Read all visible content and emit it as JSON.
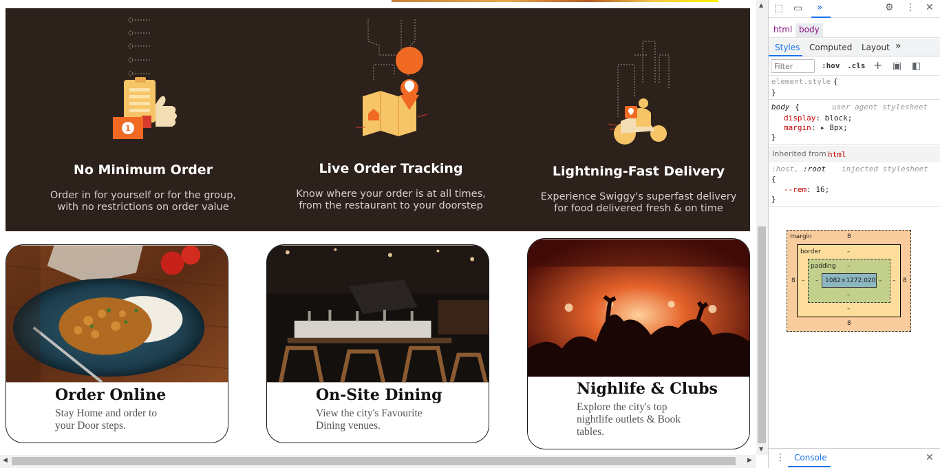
{
  "features": [
    {
      "title": "No Minimum Order",
      "desc_line1": "Order in for yourself or for the group,",
      "desc_line2": "with no restrictions on order value",
      "icon": "thumbs-up-order-icon",
      "badge": "1"
    },
    {
      "title": "Live Order Tracking",
      "desc_line1": "Know where your order is at all times,",
      "desc_line2": "from the restaurant to your doorstep",
      "icon": "map-pin-tracking-icon"
    },
    {
      "title": "Lightning-Fast Delivery",
      "desc_line1": "Experience Swiggy's superfast delivery",
      "desc_line2": "for food delivered fresh & on time",
      "icon": "delivery-scooter-icon"
    }
  ],
  "cards": [
    {
      "title": "Order Online",
      "desc_line1": "Stay Home and order to",
      "desc_line2": "your Door steps.",
      "image": "curry-rice-plate-photo"
    },
    {
      "title": "On-Site Dining",
      "desc_line1": "View the city's Favourite",
      "desc_line2": "Dining venues.",
      "image": "restaurant-interior-photo"
    },
    {
      "title": "Nighlife & Clubs",
      "desc_line1": "Explore the city's top",
      "desc_line2": "nightlife outlets & Book",
      "desc_line3": "tables.",
      "image": "concert-crowd-photo"
    }
  ],
  "devtools": {
    "breadcrumbs": [
      "html",
      "body"
    ],
    "tabs": [
      "Styles",
      "Computed",
      "Layout"
    ],
    "more_tabs": "»",
    "filter_placeholder": "Filter",
    "hov": ":hov",
    "cls": ".cls",
    "element_style": {
      "selector": "element.style",
      "open": "{",
      "close": "}"
    },
    "body_rule": {
      "selector": "body",
      "open": "{",
      "source": "user agent stylesheet",
      "props": [
        {
          "name": "display",
          "value": "block;"
        },
        {
          "name": "margin",
          "value": "8px;"
        }
      ],
      "close": "}"
    },
    "inherited_label": "Inherited from",
    "inherited_from": "html",
    "host_rule": {
      "selector1": ":host,",
      "selector2": ":root",
      "source": "injected stylesheet",
      "open": "{",
      "props": [
        {
          "name": "--rem",
          "value": "16;"
        }
      ],
      "close": "}"
    },
    "box_model": {
      "margin_label": "margin",
      "border_label": "border",
      "padding_label": "padding",
      "margin": "8",
      "border": "–",
      "padding": "–",
      "content": "1082×1272.020"
    },
    "console_label": "Console"
  },
  "colors": {
    "feature_bg": "#2d211c",
    "accent_orange": "#fc8019",
    "accent_yellow": "#f6c567",
    "devtools_blue": "#1a73e8"
  }
}
